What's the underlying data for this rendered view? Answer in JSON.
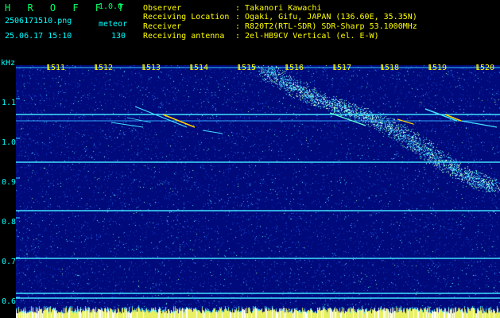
{
  "header": {
    "app_title": "H R O F F T",
    "version": "1.0.0",
    "file_name": "2506171510.png",
    "meteor_label": "meteor",
    "datetime": "25.06.17 15:10",
    "meteor_count": "130",
    "info": [
      {
        "key": "Observer",
        "value": ": Takanori Kawachi"
      },
      {
        "key": "Receiving Location",
        "value": ": Ogaki, Gifu, JAPAN (136.60E, 35.35N)"
      },
      {
        "key": "Receiver",
        "value": ": R820T2(RTL-SDR) SDR-Sharp 53.1000MHz"
      },
      {
        "key": "Receiving antenna",
        "value": ": 2el-HB9CV Vertical (el. E-W)"
      }
    ]
  },
  "plot": {
    "unit": "kHz",
    "x_ticks": [
      "1511",
      "1512",
      "1513",
      "1514",
      "1515",
      "1516",
      "1517",
      "1518",
      "1519",
      "1520"
    ],
    "y_ticks": [
      "1.1",
      "1.0",
      "0.9",
      "0.8",
      "0.7",
      "0.6"
    ],
    "colors": {
      "background": "#000a7a",
      "grid": "#2fd0ff",
      "signal": "#00ffcc",
      "hot": "#ffd000",
      "labels_y": "#00ffff",
      "labels_x": "#ffff00"
    }
  }
}
